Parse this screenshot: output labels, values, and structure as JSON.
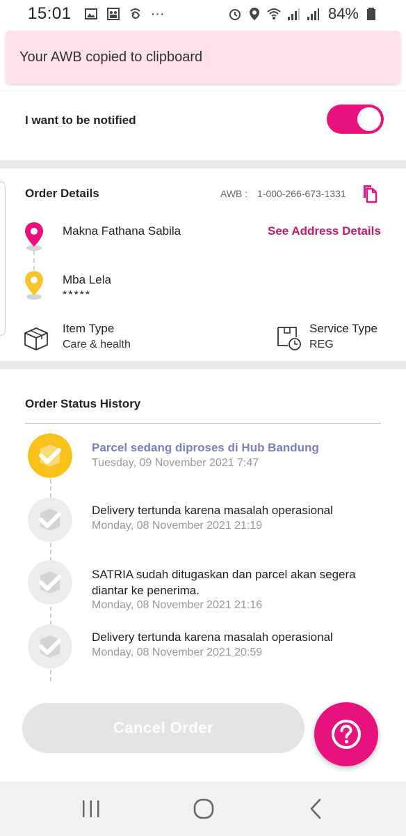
{
  "status_bar": {
    "time": "15:01",
    "more": "···",
    "battery_pct": "84%",
    "icons": [
      "gallery-icon",
      "photo-icon",
      "app-icon",
      "alarm-icon",
      "location-icon",
      "wifi-icon",
      "signal-icon",
      "signal-icon",
      "battery-icon"
    ]
  },
  "toast": {
    "message": "Your AWB copied to clipboard"
  },
  "notify": {
    "label": "I want to be notified",
    "enabled": true
  },
  "order_details": {
    "title": "Order Details",
    "awb_label": "AWB :",
    "awb_value": "1-000-266-673-1331",
    "sender_name": "Makna Fathana Sabila",
    "see_address": "See Address Details",
    "receiver_name": "Mba Lela",
    "receiver_phone": "*****",
    "item_type_label": "Item Type",
    "item_type_value": "Care & health",
    "service_type_label": "Service Type",
    "service_type_value": "REG"
  },
  "status_history": {
    "title": "Order Status History",
    "steps": [
      {
        "title": "Parcel sedang diproses di Hub Bandung",
        "time": "Tuesday, 09 November 2021 7:47",
        "active": true
      },
      {
        "title": "Delivery tertunda karena masalah operasional",
        "time": "Monday, 08 November 2021 21:19",
        "active": false
      },
      {
        "title": "SATRIA sudah ditugaskan dan parcel akan segera diantar ke penerima.",
        "time": "Monday, 08 November 2021 21:16",
        "active": false
      },
      {
        "title": "Delivery tertunda karena masalah operasional",
        "time": "Monday, 08 November 2021 20:59",
        "active": false
      }
    ]
  },
  "actions": {
    "cancel_label": "Cancel Order",
    "help_icon": "help-icon"
  },
  "colors": {
    "accent": "#e8127d",
    "active_step": "#7a7fc0",
    "pin_yellow": "#f7c52b",
    "toast_bg": "#fde0ea"
  }
}
